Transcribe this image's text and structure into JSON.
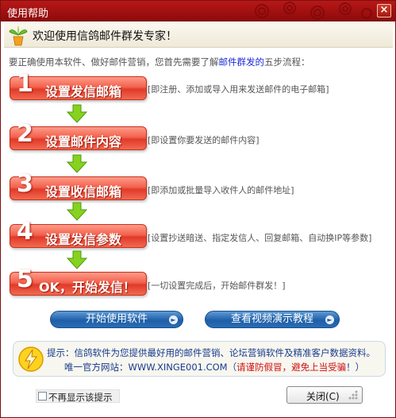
{
  "window": {
    "title": "使用帮助",
    "close_glyph": "×"
  },
  "header": {
    "icon": "plant-sprout-icon",
    "text": "欢迎使用信鸽邮件群发专家！"
  },
  "intro": {
    "text_before": "要正确使用本软件、做好邮件营销，您首先需要了解",
    "link": "邮件群发的",
    "text_after": "五步流程："
  },
  "steps": [
    {
      "number": "1",
      "label": "设置发信邮箱",
      "note": "[即注册、添加或导入用来发送邮件的电子邮箱]"
    },
    {
      "number": "2",
      "label": "设置邮件内容",
      "note": "[即设置你要发送的邮件内容]"
    },
    {
      "number": "3",
      "label": "设置收信邮箱",
      "note": "[即添加或批量导入收件人的邮件地址]"
    },
    {
      "number": "4",
      "label": "设置发信参数",
      "note": "[设置抄送暗送、指定发信人、回复邮箱、自动换IP等参数]"
    },
    {
      "number": "5",
      "label": "OK，开始发信！",
      "note": "[一切设置完成后，开始邮件群发！]"
    }
  ],
  "buttons": {
    "start": "开始使用软件",
    "video": "查看视频演示教程",
    "close": "关闭(C)"
  },
  "tip": {
    "line1": "提示：信鸽软件为您提供最好用的邮件营销、论坛营销软件及精准客户数据资料。",
    "line2_before": "唯一官方网站：WWW.XINGE001.COM（",
    "line2_red": "请谨防假冒，避免上当受骗",
    "line2_after": "！）"
  },
  "dont_show": {
    "label": "不再显示该提示",
    "checked": false
  },
  "colors": {
    "titlebar": "#a01414",
    "step_red": "#e03a28",
    "arrow_green": "#7fcc1a",
    "pill_blue": "#1e5fa8",
    "link_blue": "#1a2bd8"
  }
}
